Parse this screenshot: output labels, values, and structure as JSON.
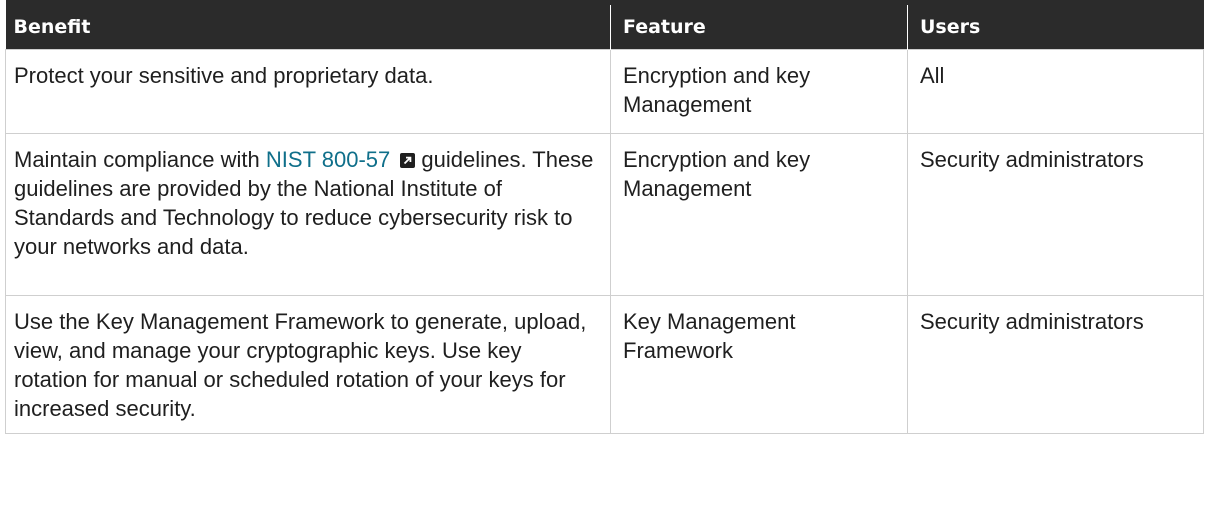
{
  "table": {
    "headers": [
      "Benefit",
      "Feature",
      "Users"
    ],
    "rows": [
      {
        "benefit": "Protect your sensitive and proprietary data.",
        "feature": "Encryption and key Management",
        "users": "All"
      },
      {
        "benefit_prefix": "Maintain compliance with ",
        "benefit_link": "NIST 800-57",
        "benefit_suffix": " guidelines. These guidelines are provided by the National Institute of Standards and Technology to reduce cybersecurity risk to your networks and data.",
        "feature": "Encryption and key Management",
        "users": "Security administrators"
      },
      {
        "benefit": "Use the Key Management Framework to generate, upload, view, and manage your cryptographic keys. Use key rotation for manual or scheduled rotation of your keys for increased security.",
        "feature": "Key Management Framework",
        "users": "Security administrators"
      }
    ]
  },
  "colors": {
    "header_bg": "#2b2b2b",
    "link": "#0f6f8a",
    "border": "#cfcfcf"
  },
  "icons": {
    "external_link": "external-link-icon"
  }
}
